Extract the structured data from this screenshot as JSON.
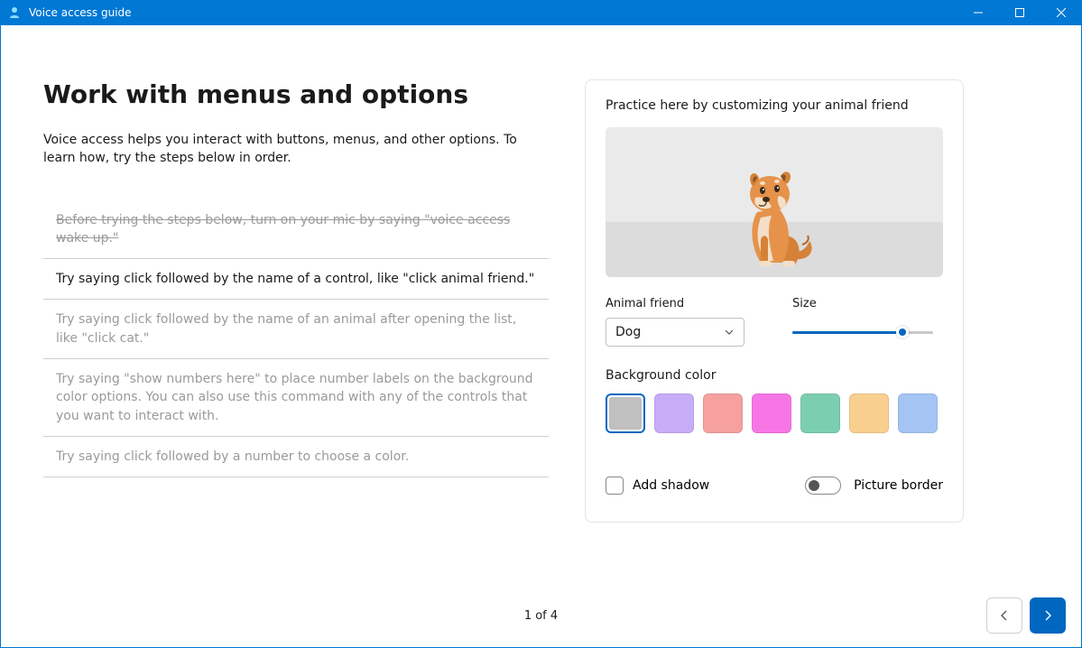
{
  "window": {
    "title": "Voice access guide"
  },
  "page": {
    "heading": "Work with menus and options",
    "intro": "Voice access helps you interact with buttons, menus, and other options. To learn how, try the steps below in order.",
    "steps": [
      {
        "text": "Before trying the steps below, turn on your mic by saying \"voice access wake up.\"",
        "state": "done"
      },
      {
        "text": "Try saying click followed by the name of a control, like \"click animal friend.\"",
        "state": "current"
      },
      {
        "text": "Try saying click followed by the name of an animal after opening the list, like \"click cat.\"",
        "state": "pending"
      },
      {
        "text": "Try saying \"show numbers here\" to place number labels on the background color options. You can also use this command with any of the controls that you want to interact with.",
        "state": "pending"
      },
      {
        "text": "Try saying click followed by a number to choose a color.",
        "state": "pending"
      }
    ],
    "page_indicator": "1 of 4"
  },
  "practice": {
    "title": "Practice here by customizing your animal friend",
    "animal_label": "Animal friend",
    "animal_value": "Dog",
    "size_label": "Size",
    "size_value": 78,
    "bg_label": "Background color",
    "colors": [
      {
        "hex": "#c0c0c0",
        "selected": true
      },
      {
        "hex": "#c7adf8"
      },
      {
        "hex": "#f6a0a0"
      },
      {
        "hex": "#f776e6"
      },
      {
        "hex": "#7bcfb0"
      },
      {
        "hex": "#f8cf8e"
      },
      {
        "hex": "#a4c4f4"
      }
    ],
    "shadow_label": "Add shadow",
    "shadow_checked": false,
    "border_label": "Picture border",
    "border_on": false
  }
}
